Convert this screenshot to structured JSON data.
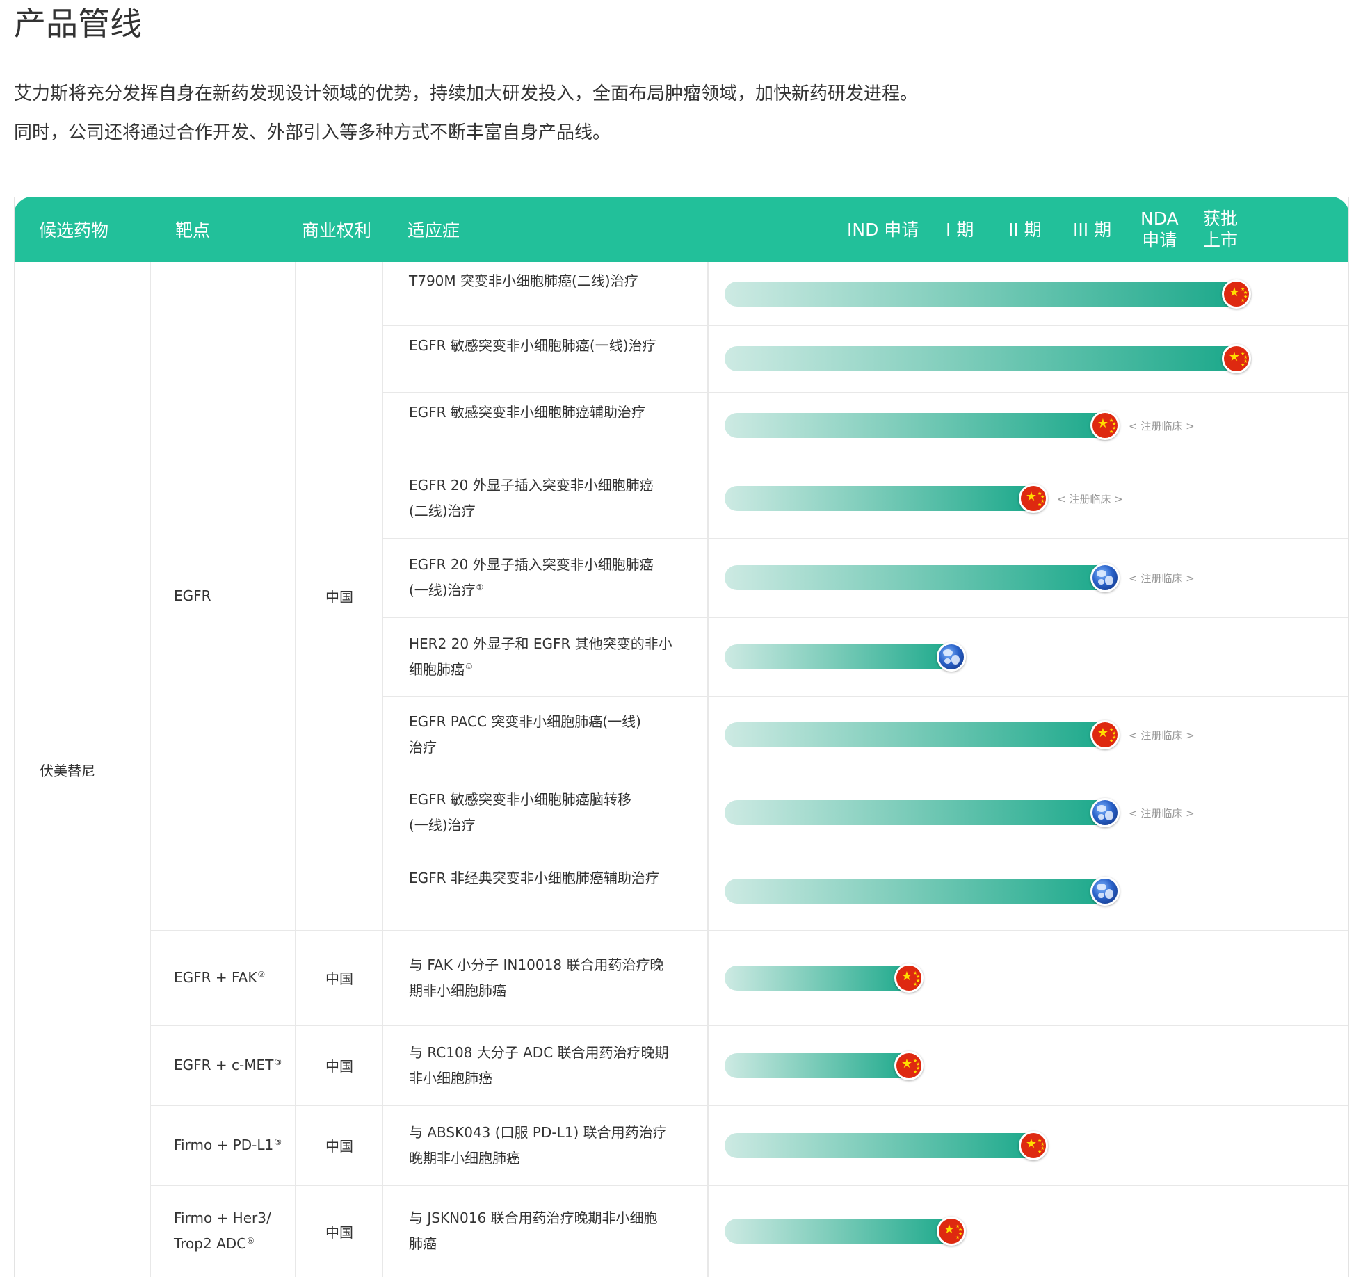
{
  "page": {
    "title": "产品管线",
    "intro": [
      "艾力斯将充分发挥自身在新药发现设计领域的优势，持续加大研发投入，全面布局肿瘤领域，加快新药研发进程。",
      "同时，公司还将通过合作开发、外部引入等多种方式不断丰富自身产品线。"
    ]
  },
  "table": {
    "headers": {
      "drug": "候选药物",
      "target": "靶点",
      "rights": "商业权利",
      "indication": "适应症",
      "stages": [
        {
          "line1": "IND 申请",
          "line2": ""
        },
        {
          "line1": "I 期",
          "line2": ""
        },
        {
          "line1": "II 期",
          "line2": ""
        },
        {
          "line1": "III 期",
          "line2": ""
        },
        {
          "line1": "NDA",
          "line2": "申请"
        },
        {
          "line1": "获批",
          "line2": "上市"
        }
      ]
    },
    "drug": "伏美替尼",
    "groups": [
      {
        "target": "EGFR",
        "target_sup": "",
        "rights": "中国"
      },
      {
        "target": "EGFR + FAK",
        "target_sup": "②",
        "rights": "中国"
      },
      {
        "target": "EGFR + c-MET",
        "target_sup": "③",
        "rights": "中国"
      },
      {
        "target": "Firmo + PD-L1",
        "target_sup": "⑤",
        "rights": "中国"
      },
      {
        "target_line1": "Firmo + Her3/",
        "target_line2": "Trop2 ADC",
        "target_sup": "⑥",
        "rights": "中国"
      }
    ],
    "rows": [
      {
        "line1": "T790M 突变非小细胞肺癌(二线)治疗",
        "line2": "",
        "sup": "",
        "region": "china",
        "progress": 1.0,
        "note": ""
      },
      {
        "line1": "EGFR 敏感突变非小细胞肺癌(一线)治疗",
        "line2": "",
        "sup": "",
        "region": "china",
        "progress": 1.0,
        "note": ""
      },
      {
        "line1": "EGFR 敏感突变非小细胞肺癌辅助治疗",
        "line2": "",
        "sup": "",
        "region": "china",
        "progress": 0.745,
        "note": "< 注册临床 >"
      },
      {
        "line1": "EGFR 20 外显子插入突变非小细胞肺癌",
        "line2": "(二线)治疗",
        "sup": "",
        "region": "china",
        "progress": 0.607,
        "note": "< 注册临床 >"
      },
      {
        "line1": "EGFR 20 外显子插入突变非小细胞肺癌",
        "line2": "(一线)治疗",
        "sup": "①",
        "region": "global",
        "progress": 0.745,
        "note": "< 注册临床 >"
      },
      {
        "line1": "HER2 20 外显子和 EGFR 其他突变的非小",
        "line2": "细胞肺癌",
        "sup": "①",
        "region": "global",
        "progress": 0.448,
        "note": ""
      },
      {
        "line1": "EGFR PACC 突变非小细胞肺癌(一线)",
        "line2": "治疗",
        "sup": "",
        "region": "china",
        "progress": 0.745,
        "note": "< 注册临床 >"
      },
      {
        "line1": "EGFR 敏感突变非小细胞肺癌脑转移",
        "line2": "(一线)治疗",
        "sup": "",
        "region": "global",
        "progress": 0.745,
        "note": "< 注册临床 >"
      },
      {
        "line1": "EGFR 非经典突变非小细胞肺癌辅助治疗",
        "line2": "",
        "sup": "",
        "region": "global",
        "progress": 0.745,
        "note": ""
      },
      {
        "line1": "与 FAK 小分子 IN10018 联合用药治疗晚",
        "line2": "期非小细胞肺癌",
        "sup": "",
        "region": "china",
        "progress": 0.365,
        "note": ""
      },
      {
        "line1": "与 RC108 大分子 ADC 联合用药治疗晚期",
        "line2": "非小细胞肺癌",
        "sup": "",
        "region": "china",
        "progress": 0.365,
        "note": ""
      },
      {
        "line1": "与 ABSK043 (口服 PD-L1) 联合用药治疗",
        "line2": "晚期非小细胞肺癌",
        "sup": "",
        "region": "china",
        "progress": 0.607,
        "note": ""
      },
      {
        "line1": "与 JSKN016 联合用药治疗晚期非小细胞",
        "line2": "肺癌",
        "sup": "",
        "region": "china",
        "progress": 0.448,
        "note": ""
      }
    ],
    "colors": {
      "header_bg": "#22c09a",
      "bar_start": "#cdeae3",
      "bar_end": "#1aa88a",
      "china_red": "#de2910",
      "star_yellow": "#ffde00"
    },
    "icons": {
      "china": "china-flag-icon",
      "global": "globe-icon"
    }
  }
}
